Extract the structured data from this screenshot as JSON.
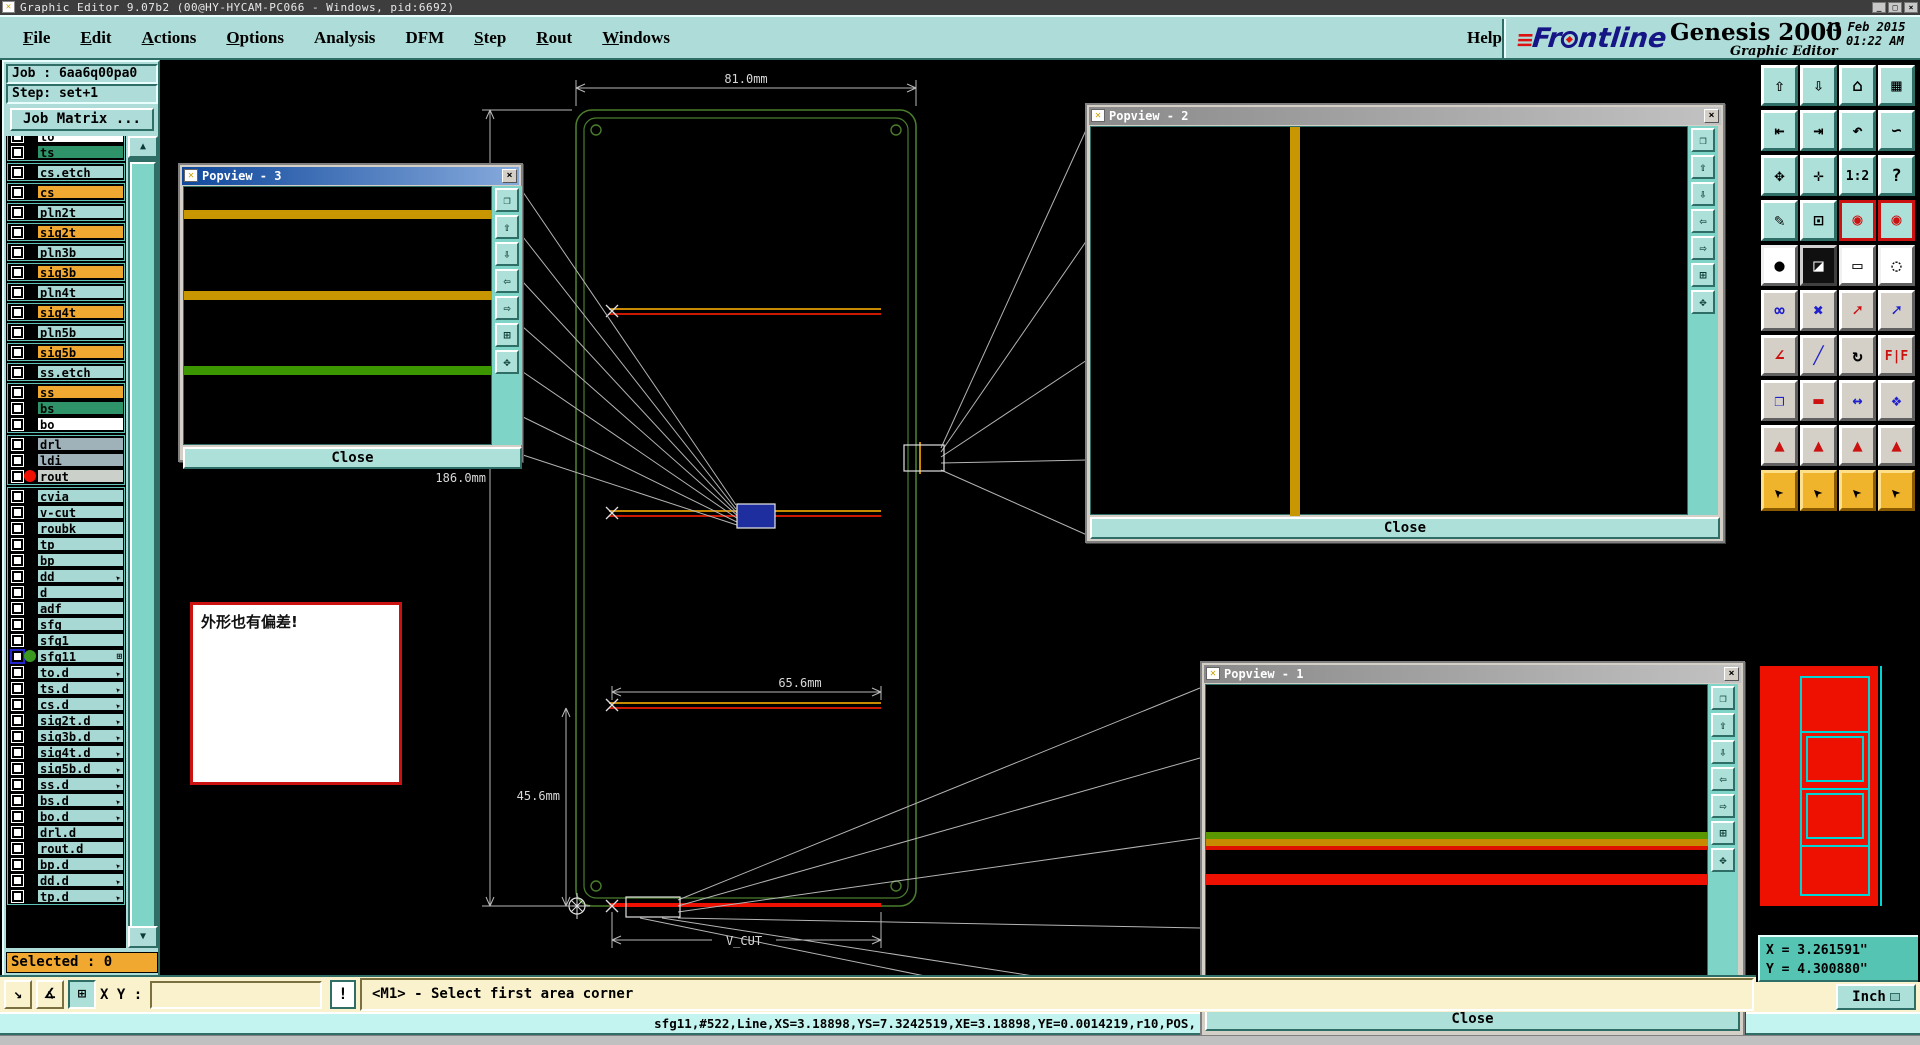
{
  "titlebar": {
    "title": "Graphic Editor 9.07b2 (00@HY-HYCAM-PC066 - Windows, pid:6692)",
    "icon": "window-x-icon",
    "min": "_",
    "max": "□",
    "close": "×"
  },
  "menubar": {
    "menus": [
      {
        "label": "File",
        "ul": 0
      },
      {
        "label": "Edit",
        "ul": 0
      },
      {
        "label": "Actions",
        "ul": 0
      },
      {
        "label": "Options",
        "ul": 0
      },
      {
        "label": "Analysis",
        "ul": -1
      },
      {
        "label": "DFM",
        "ul": -1
      },
      {
        "label": "Step",
        "ul": 0
      },
      {
        "label": "Rout",
        "ul": 0
      },
      {
        "label": "Windows",
        "ul": 0
      }
    ],
    "help": "Help"
  },
  "brand": {
    "logo_speed": "≡",
    "logo_left": "Fr",
    "logo_right": "ntline",
    "product": "Genesis 2000",
    "date": "13 Feb 2015",
    "time": "01:22 AM",
    "subtitle": "Graphic Editor"
  },
  "job_panel": {
    "job": "Job : 6aa6q00pa0",
    "step": "Step: set+1",
    "matrix": "Job Matrix ...",
    "selected": "Selected : 0",
    "scroll_up": "▲",
    "scroll_down": "▼"
  },
  "layers": [
    {
      "name": "to",
      "c": "white",
      "g": 0
    },
    {
      "name": "ts",
      "c": "green",
      "g": 0
    },
    {
      "name": "cs.etch",
      "c": "teal",
      "g": 1
    },
    {
      "name": "cs",
      "c": "orange",
      "g": 2
    },
    {
      "name": "pln2t",
      "c": "teal",
      "g": 3
    },
    {
      "name": "sig2t",
      "c": "orange",
      "g": 4
    },
    {
      "name": "pln3b",
      "c": "teal",
      "g": 5
    },
    {
      "name": "sig3b",
      "c": "orange",
      "g": 6
    },
    {
      "name": "pln4t",
      "c": "teal",
      "g": 7
    },
    {
      "name": "sig4t",
      "c": "orange",
      "g": 8
    },
    {
      "name": "pln5b",
      "c": "teal",
      "g": 9
    },
    {
      "name": "sig5b",
      "c": "orange",
      "g": 10
    },
    {
      "name": "ss.etch",
      "c": "teal",
      "g": 11
    },
    {
      "name": "ss",
      "c": "orange",
      "g": 12
    },
    {
      "name": "bs",
      "c": "green",
      "g": 12
    },
    {
      "name": "bo",
      "c": "white",
      "g": 12
    },
    {
      "name": "drl",
      "c": "gray",
      "g": 13
    },
    {
      "name": "ldi",
      "c": "gray",
      "g": 13
    },
    {
      "name": "rout",
      "c": "lgray",
      "g": 13,
      "m": "red"
    },
    {
      "name": "cvia",
      "c": "teal",
      "g": 14
    },
    {
      "name": "v-cut",
      "c": "teal",
      "g": 14
    },
    {
      "name": "roubk",
      "c": "teal",
      "g": 14
    },
    {
      "name": "tp",
      "c": "teal",
      "g": 14
    },
    {
      "name": "bp",
      "c": "teal",
      "g": 14
    },
    {
      "name": "dd",
      "c": "teal",
      "g": 14,
      "a": 1
    },
    {
      "name": "d",
      "c": "teal",
      "g": 14
    },
    {
      "name": "adf",
      "c": "teal",
      "g": 14
    },
    {
      "name": "sfg",
      "c": "teal",
      "g": 14
    },
    {
      "name": "sfg1",
      "c": "teal",
      "g": 14
    },
    {
      "name": "sfg11",
      "c": "teal",
      "g": 14,
      "m": "green",
      "grid": 1,
      "hl": 1
    },
    {
      "name": "to.d",
      "c": "teal",
      "g": 14,
      "a": 1
    },
    {
      "name": "ts.d",
      "c": "teal",
      "g": 14,
      "a": 1
    },
    {
      "name": "cs.d",
      "c": "teal",
      "g": 14,
      "a": 1
    },
    {
      "name": "sig2t.d",
      "c": "teal",
      "g": 14,
      "a": 1
    },
    {
      "name": "sig3b.d",
      "c": "teal",
      "g": 14,
      "a": 1
    },
    {
      "name": "sig4t.d",
      "c": "teal",
      "g": 14,
      "a": 1
    },
    {
      "name": "sig5b.d",
      "c": "teal",
      "g": 14,
      "a": 1
    },
    {
      "name": "ss.d",
      "c": "teal",
      "g": 14,
      "a": 1
    },
    {
      "name": "bs.d",
      "c": "teal",
      "g": 14,
      "a": 1
    },
    {
      "name": "bo.d",
      "c": "teal",
      "g": 14,
      "a": 1
    },
    {
      "name": "drl.d",
      "c": "teal",
      "g": 14
    },
    {
      "name": "rout.d",
      "c": "teal",
      "g": 14
    },
    {
      "name": "bp.d",
      "c": "teal",
      "g": 14,
      "a": 1
    },
    {
      "name": "dd.d",
      "c": "teal",
      "g": 14,
      "a": 1
    },
    {
      "name": "tp.d",
      "c": "teal",
      "g": 14,
      "a": 1
    }
  ],
  "layer_colors": {
    "teal": "#a8d8d4",
    "orange": "#f0a830",
    "green": "#2e9368",
    "white": "#ffffff",
    "gray": "#9fb2ba",
    "lgray": "#cbd0cb"
  },
  "toolbar": [
    {
      "n": "zoom-in-button",
      "g": "⇧",
      "c": "t"
    },
    {
      "n": "zoom-out-button",
      "g": "⇩",
      "c": "t"
    },
    {
      "n": "home-view-button",
      "g": "⌂",
      "c": "t"
    },
    {
      "n": "window-xy-button",
      "g": "▦",
      "c": "t"
    },
    {
      "n": "pan-left-button",
      "g": "⇤",
      "c": "t"
    },
    {
      "n": "pan-right-button",
      "g": "⇥",
      "c": "t"
    },
    {
      "n": "undo-view-button",
      "g": "↶",
      "c": "t"
    },
    {
      "n": "serpentine-button",
      "g": "∽",
      "c": "t"
    },
    {
      "n": "fit-view-button",
      "g": "✥",
      "c": "t"
    },
    {
      "n": "center-view-button",
      "g": "✛",
      "c": "t"
    },
    {
      "n": "scale-1-2-button",
      "g": "1:2",
      "c": "t small"
    },
    {
      "n": "help-button",
      "g": "?",
      "c": "t"
    },
    {
      "n": "draw-tools-button",
      "g": "✎",
      "c": "t"
    },
    {
      "n": "grid-origin-button",
      "g": "⊡",
      "c": "t"
    },
    {
      "n": "net-compare-a-button",
      "g": "◉",
      "c": "ts cr"
    },
    {
      "n": "net-compare-b-button",
      "g": "◉",
      "c": "ts cr"
    },
    {
      "n": "pad-edit-button",
      "g": "●",
      "c": "w"
    },
    {
      "n": "transform-button",
      "g": "◪",
      "c": "k cr"
    },
    {
      "n": "ruler-button",
      "g": "▭",
      "c": "w"
    },
    {
      "n": "select-area-button",
      "g": "◌",
      "c": "w"
    },
    {
      "n": "chain-select-button",
      "g": "∞",
      "c": "gr cb"
    },
    {
      "n": "delete-button",
      "g": "✖",
      "c": "gr cb"
    },
    {
      "n": "move-point-button",
      "g": "➚",
      "c": "gr cr"
    },
    {
      "n": "copy-point-button",
      "g": "➚",
      "c": "gr cb"
    },
    {
      "n": "angle-measure-button",
      "g": "∠",
      "c": "gr cr"
    },
    {
      "n": "slope-line-button",
      "g": "╱",
      "c": "gr cb"
    },
    {
      "n": "arc-rotate-button",
      "g": "↻",
      "c": "gr"
    },
    {
      "n": "mirror-button",
      "g": "F|F",
      "c": "gr cr small"
    },
    {
      "n": "copy-pad-button",
      "g": "❐",
      "c": "gr cb"
    },
    {
      "n": "stretch-line-button",
      "g": "▬",
      "c": "gr cr"
    },
    {
      "n": "gap-measure-button",
      "g": "↔",
      "c": "gr cb"
    },
    {
      "n": "boolean-shapes-button",
      "g": "❖",
      "c": "gr cb"
    },
    {
      "n": "drc-arrow-1-button",
      "g": "▲",
      "c": "gr cr"
    },
    {
      "n": "drc-arrow-2-button",
      "g": "▲",
      "c": "gr cr"
    },
    {
      "n": "drc-arrow-3-button",
      "g": "▲",
      "c": "gr cr"
    },
    {
      "n": "drc-arrow-4-button",
      "g": "▲",
      "c": "gr cr"
    },
    {
      "n": "cursor-select-button",
      "g": "➤",
      "c": "o curs-b"
    },
    {
      "n": "cursor-frame-button",
      "g": "➤",
      "c": "o curs-b"
    },
    {
      "n": "cursor-octagon-button",
      "g": "➤",
      "c": "o curs-b"
    },
    {
      "n": "cursor-net-button",
      "g": "➤",
      "c": "o curs-b"
    }
  ],
  "popviews": [
    {
      "title": "Popview - 1",
      "close_x": "×",
      "close": "Close"
    },
    {
      "title": "Popview - 2",
      "close_x": "×",
      "close": "Close"
    },
    {
      "title": "Popview - 3",
      "close_x": "×",
      "close": "Close"
    }
  ],
  "popview_buttons": [
    {
      "n": "window-duplicate-button",
      "g": "❐"
    },
    {
      "n": "pan-up-button",
      "g": "⇧"
    },
    {
      "n": "pan-down-button",
      "g": "⇩"
    },
    {
      "n": "pan-left-button",
      "g": "⇦"
    },
    {
      "n": "pan-right-button",
      "g": "⇨"
    },
    {
      "n": "zoom-grid-button",
      "g": "⊞"
    },
    {
      "n": "pan-center-button",
      "g": "✥"
    }
  ],
  "drawing": {
    "dim_width": "81.0mm",
    "dim_height": "186.0mm",
    "dim_inner": "65.6mm",
    "dim_bottom": "45.6mm",
    "vcut_label": "V_CUT",
    "note": "外形也有偏差!"
  },
  "command": {
    "zoom_area_glyph": "↘",
    "angle_glyph": "∡",
    "grid_glyph": "⊞",
    "xy_label": "X Y :",
    "xy_value": "",
    "bang": "!",
    "prompt": "<M1> - Select first area corner"
  },
  "status_detail": "sfg11,#522,Line,XS=3.18898,YS=7.3242519,XE=3.18898,YE=0.0014219,r10,POS,",
  "readout": {
    "x": "X = 3.261591\"",
    "y": "Y = 4.300880\"",
    "units": "Inch"
  },
  "colors": {
    "ui_teal": "#aedcd8",
    "cream": "#faf2cc",
    "status_cyan": "#c4f4f0",
    "layer_orange": "#f0a830",
    "bar_orange": "#c89600",
    "bar_green": "#3c9600",
    "red": "#ee1000",
    "board_green": "#4a7c2c",
    "navigator_cyan": "#00d4d4"
  }
}
